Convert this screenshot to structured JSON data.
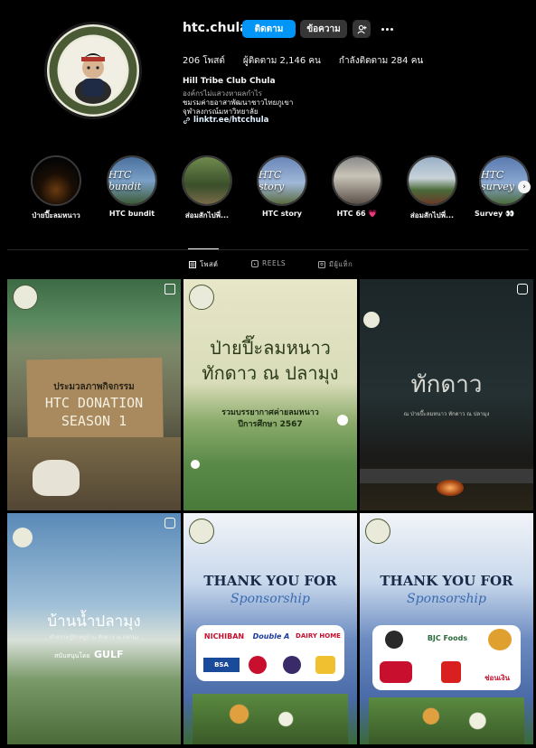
{
  "profile": {
    "username": "htc.chula",
    "buttons": {
      "follow": "ติดตาม",
      "message": "ข้อความ"
    },
    "stats": {
      "posts": "206 โพสต์",
      "followers": "ผู้ติดตาม 2,146 คน",
      "following": "กำลังติดตาม 284 คน"
    },
    "bio": {
      "name": "Hill Tribe Club Chula",
      "category": "องค์กรไม่แสวงหาผลกำไร",
      "line1": "ชมรมค่ายอาสาพัฒนาชาวไทยภูเขา",
      "line2": "จุฬาลงกรณ์มหาวิทยาลัย",
      "link": "linktr.ee/htcchula"
    },
    "avatar_text": {
      "top": "HILL TRIBE CLUB",
      "bottom": "2 5 1 6"
    }
  },
  "highlights": [
    {
      "label": "ป่ายปี๊ะลมหนาว",
      "cover": ""
    },
    {
      "label": "HTC bundit",
      "cover": "HTC bundit"
    },
    {
      "label": "ส่อมสักไปพี่...",
      "cover": ""
    },
    {
      "label": "HTC story",
      "cover": "HTC story"
    },
    {
      "label": "HTC 66 💗",
      "cover": ""
    },
    {
      "label": "ส่อมสักไปพี่...",
      "cover": ""
    },
    {
      "label": "Survey 👀",
      "cover": "HTC survey"
    }
  ],
  "tabs": [
    {
      "label": "โพสต์",
      "icon": "grid-icon"
    },
    {
      "label": "REELS",
      "icon": "reels-icon"
    },
    {
      "label": "มีผู้แท็ก",
      "icon": "tagged-icon"
    }
  ],
  "posts": [
    {
      "subtitle": "ประมวลภาพกิจกรรม",
      "title1": "HTC DONATION",
      "title2": "SEASON 1"
    },
    {
      "title1": "ป่ายปี๊ะลมหนาว",
      "title2": "ทักดาว ณ ปลามุง",
      "subtitle": "รวมบรรยากาศค่ายลมหนาว",
      "sub2": "ปีการศึกษา 2567"
    },
    {
      "title1": "ทักดาว",
      "subtitle": "ณ ป่ายปี๊ะลมหนาว ทักดาว ณ ปลามุง"
    },
    {
      "title1": "บ้านน้ำปลามุง",
      "subtitle": "ทำความรู้จักหมู่บ้าน ทักดาว ณ ปลามุง",
      "sponsor": "สนับสนุนโดย",
      "sponsor_brand": "GULF"
    },
    {
      "title1": "THANK YOU FOR",
      "title2": "Sponsorship",
      "brands": [
        "NICHIBAN",
        "Double A",
        "DAIRY HOME",
        "BSA",
        "",
        "",
        ""
      ]
    },
    {
      "title1": "THANK YOU FOR",
      "title2": "Sponsorship",
      "brands": [
        "",
        "BJC Foods",
        "",
        "",
        "",
        "ช่อนเงิน"
      ]
    }
  ],
  "colors": {
    "accent": "#0095f6",
    "bg": "#000000",
    "secondary_btn": "#363636"
  }
}
